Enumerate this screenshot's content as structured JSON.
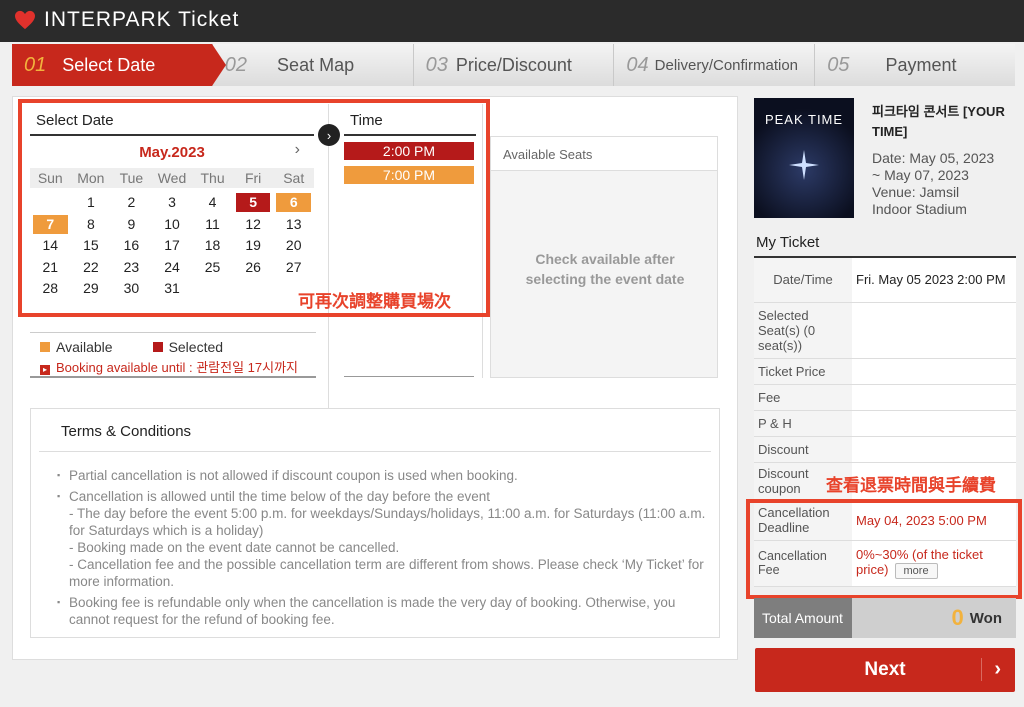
{
  "header": {
    "brand": "INTERPARK  Ticket"
  },
  "steps": [
    {
      "num": "01",
      "label": "Select Date"
    },
    {
      "num": "02",
      "label": "Seat Map"
    },
    {
      "num": "03",
      "label": "Price/Discount"
    },
    {
      "num": "04",
      "label": "Delivery/Confirmation"
    },
    {
      "num": "05",
      "label": "Payment"
    }
  ],
  "calendar": {
    "title": "Select Date",
    "month": "May.2023",
    "next": "›",
    "dow": [
      "Sun",
      "Mon",
      "Tue",
      "Wed",
      "Thu",
      "Fri",
      "Sat"
    ]
  },
  "time": {
    "title": "Time",
    "slot1": "2:00 PM",
    "slot2": "7:00 PM"
  },
  "seats": {
    "title": "Available Seats",
    "msg1": "Check available after",
    "msg2": "selecting the event date"
  },
  "legend": {
    "available": "Available",
    "selected": "Selected",
    "booking": "Booking available until : 관람전일 17시까지"
  },
  "annotations": {
    "a1": "可再次調整購買場次",
    "a2": "查看退票時間與手續費"
  },
  "terms": {
    "title": "Terms & Conditions",
    "l1": "Partial cancellation is not allowed if discount coupon is used when booking.",
    "l2a": "Cancellation is allowed until the time below of the day before the event",
    "l2b": "- The day before the event 5:00 p.m. for weekdays/Sundays/holidays, 11:00 a.m. for Saturdays (11:00 a.m. for Saturdays which is a holiday)",
    "l2c": "- Booking made on the event date cannot be cancelled.",
    "l2d": "- Cancellation fee and the possible cancellation term are different from shows. Please check ‘My Ticket’ for more information.",
    "l3": "Booking fee is refundable only when the cancellation is made the very day of booking. Otherwise, you cannot request for the refund of booking fee."
  },
  "event": {
    "poster_text": "PEAK TIME",
    "title": "피크타임 콘서트 [YOUR TIME]",
    "date1": "Date: May 05, 2023",
    "date2": "~ May 07, 2023",
    "venue1": "Venue: Jamsil",
    "venue2": "Indoor Stadium"
  },
  "my_ticket": {
    "title": "My Ticket",
    "datetime_k": "Date/Time",
    "datetime_v": "Fri. May 05 2023 2:00 PM",
    "seat_k": "Selected Seat(s) (0 seat(s))",
    "price_k": "Ticket Price",
    "fee_k": "Fee",
    "ph_k": "P & H",
    "discount_k": "Discount",
    "coupon_k": "Discount coupon",
    "deadline_k": "Cancellation Deadline",
    "deadline_v": "May 04, 2023 5:00 PM",
    "cfee_k": "Cancellation Fee",
    "cfee_v": "0%~30% (of the ticket price)",
    "more": "more"
  },
  "total": {
    "label": "Total Amount",
    "amount": "0",
    "unit": "Won"
  },
  "next": {
    "label": "Next",
    "chev": "›"
  },
  "colors": {
    "accent": "#c7281c",
    "available": "#ef9b3d",
    "annotation": "#e8432b"
  }
}
